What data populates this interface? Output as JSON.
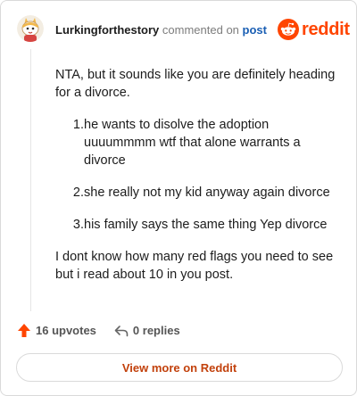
{
  "header": {
    "username": "Lurkingforthestory",
    "action": "commented on",
    "link": "post",
    "brand": "reddit"
  },
  "comment": {
    "intro": "NTA, but it sounds like you are definitely heading for a divorce.",
    "list": [
      {
        "num": "1.",
        "text": "he wants to disolve the adoption uuuummmm wtf that alone warrants a divorce"
      },
      {
        "num": "2.",
        "text": "she really not my kid anyway again divorce"
      },
      {
        "num": "3.",
        "text": "his family says the same thing Yep divorce"
      }
    ],
    "outro": "I dont know how many red flags you need to see but i read about 10 in you post."
  },
  "footer": {
    "upvotes": "16 upvotes",
    "replies": "0 replies",
    "upvote_icon": "upvote-arrow-icon",
    "reply_icon": "reply-arrow-icon"
  },
  "view_more": "View more on Reddit",
  "colors": {
    "brand": "#ff4500",
    "link": "#1a5fb4",
    "view_more_text": "#c2410c"
  }
}
